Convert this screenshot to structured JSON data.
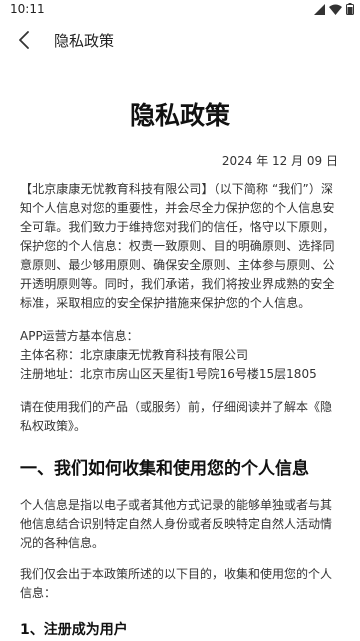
{
  "status_bar": {
    "time": "10:11",
    "icons": [
      "signal-icon",
      "wifi-icon",
      "battery-icon"
    ]
  },
  "app_bar": {
    "back_icon": "chevron-left-icon",
    "title": "隐私政策"
  },
  "document": {
    "title": "隐私政策",
    "date": "2024 年 12 月 09 日",
    "intro": "【北京康康无忧教育科技有限公司】（以下简称 “我们”）深知个人信息对您的重要性，并会尽全力保护您的个人信息安全可靠。我们致力于维持您对我们的信任，恪守以下原则，保护您的个人信息：权责一致原则、目的明确原则、选择同意原则、最少够用原则、确保安全原则、主体参与原则、公开透明原则等。同时，我们承诺，我们将按业界成熟的安全标准，采取相应的安全保护措施来保护您的个人信息。",
    "operator": {
      "heading": "APP运营方基本信息：",
      "name_line": "主体名称：北京康康无忧教育科技有限公司",
      "address_line": "注册地址：北京市房山区天星街1号院16号楼15层1805"
    },
    "read_notice": "请在使用我们的产品（或服务）前，仔细阅读并了解本《隐私权政策》。",
    "section1": {
      "heading": "一、我们如何收集和使用您的个人信息",
      "definition": "个人信息是指以电子或者其他方式记录的能够单独或者与其他信息结合识别特定自然人身份或者反映特定自然人活动情况的各种信息。",
      "purpose": "我们仅会出于本政策所述的以下目的，收集和使用您的个人信息：",
      "sub1": "1、注册成为用户"
    }
  }
}
